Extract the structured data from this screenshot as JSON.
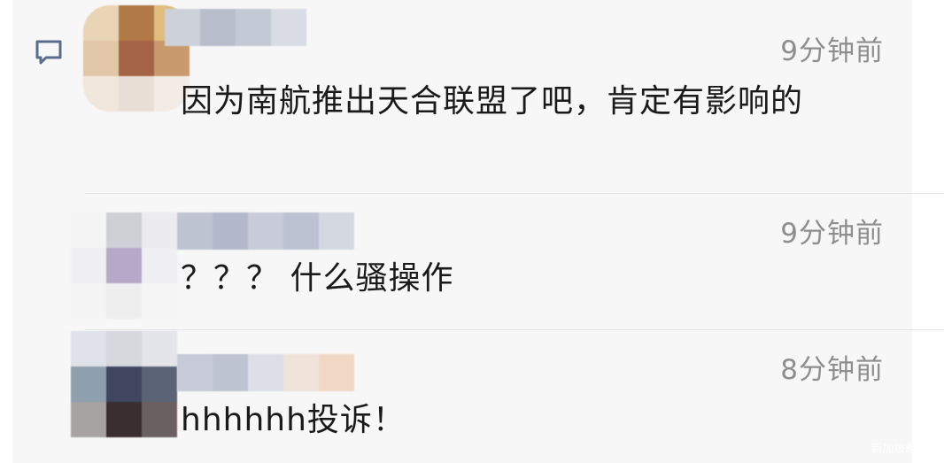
{
  "comments": [
    {
      "time": "9分钟前",
      "text": "因为南航推出天合联盟了吧，肯定有影响的",
      "avatar_colors": [
        "#e9d4b5",
        "#b07946",
        "#dfbd7f",
        "#e2c6a8",
        "#a36446",
        "#c89a6e",
        "#f0e6dc",
        "#eadfd7",
        "#f3ece6"
      ],
      "name_colors": [
        "#cdd1da",
        "#b9becd",
        "#c4c9d6",
        "#d9dce4"
      ]
    },
    {
      "time": "9分钟前",
      "text": "？？？ 什么骚操作",
      "avatar_colors": [
        "#f4f4f4",
        "#cfd0d6",
        "#ececf0",
        "#f0f0f2",
        "#b6a9c7",
        "#efeff2",
        "#f4f4f4",
        "#eeeeef",
        "#f5f5f5"
      ],
      "name_colors": [
        "#bfc4d2",
        "#b3b9cb",
        "#c7ccd8",
        "#bcc2d2",
        "#d4d8e1"
      ]
    },
    {
      "time": "8分钟前",
      "text": "hhhhhh投诉！",
      "avatar_colors": [
        "#dfe2e8",
        "#d6d8de",
        "#e4e5ea",
        "#8ea0ae",
        "#404560",
        "#5b6476",
        "#a6a3a2",
        "#3a2e30",
        "#6a6062"
      ],
      "name_colors": [
        "#c7cbd8",
        "#bfc4d3",
        "#dcdfe6",
        "#f0e3da",
        "#f1d8c6"
      ]
    }
  ],
  "watermark": "新加坡眼 Yan",
  "icon": "comment-icon"
}
